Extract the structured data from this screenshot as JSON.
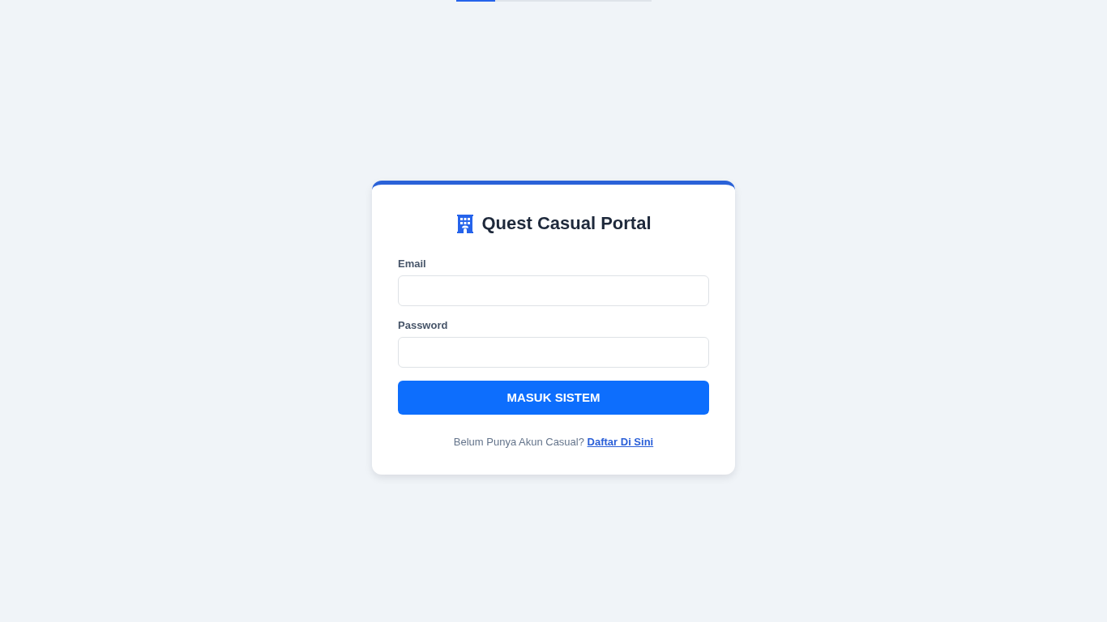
{
  "loading_bar": {
    "level": 0.2
  },
  "card": {
    "title": "Quest Casual Portal",
    "fields": [
      {
        "label": "Email"
      },
      {
        "label": "Password"
      }
    ],
    "submit": "MASUK SISTEM",
    "footer": {
      "text": "Belum Punya Akun Casual?",
      "link": "Daftar Di Sini"
    }
  }
}
